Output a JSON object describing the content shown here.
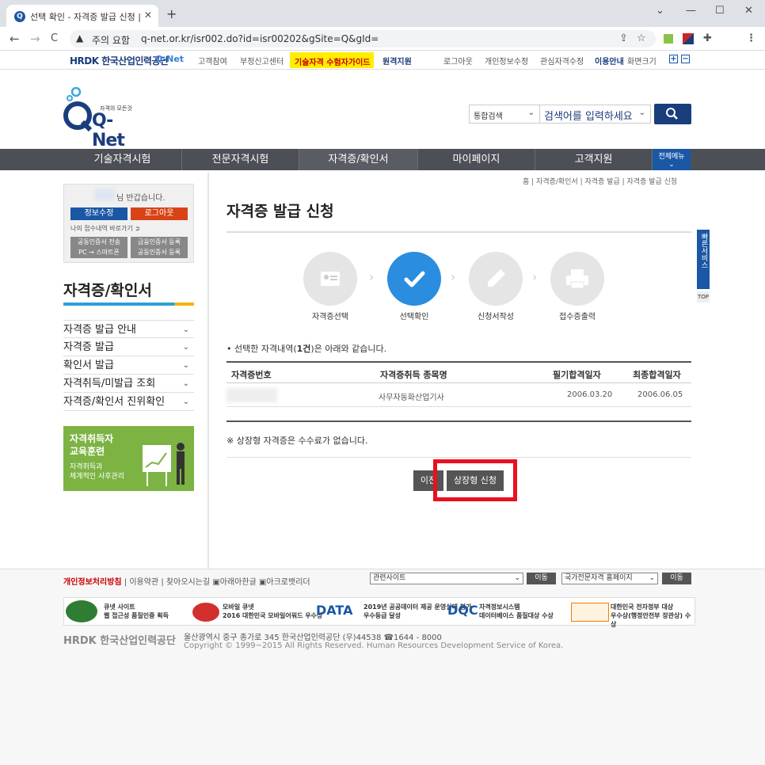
{
  "browser": {
    "tab_title": "선택 확인 - 자격증 발급 신청 | Q-",
    "tab_favicon": "Q",
    "close": "✕",
    "new_tab": "+",
    "win": [
      "⌄",
      "—",
      "☐",
      "✕"
    ],
    "nav": [
      "←",
      "→",
      "C"
    ],
    "security_label": "주의 요함",
    "url": "q-net.or.kr/isr002.do?id=isr00202&gSite=Q&gId="
  },
  "util": {
    "hrdk": "HRDK 한국산업인력공단",
    "qnet": "Q-Net",
    "links": [
      "고객참여",
      "부정신고센터"
    ],
    "guide": "기술자격 수험자가이드",
    "remote": "원격지원",
    "right_links": [
      "로그아웃",
      "개인정보수정",
      "관심자격수정",
      "이용안내",
      "화면크기"
    ],
    "plus": "+",
    "minus": "−"
  },
  "header": {
    "logo_sub": "자격의 모든것",
    "logo_main": "Q-Net",
    "search_type": "통합검색",
    "search_placeholder": "검색어를 입력하세요"
  },
  "gnb": {
    "items": [
      "기술자격시험",
      "전문자격시험",
      "자격증/확인서",
      "마이페이지",
      "고객지원"
    ],
    "all_menu": "전체메뉴"
  },
  "login": {
    "welcome": "님 반갑습니다.",
    "edit": "정보수정",
    "logout": "로그아웃",
    "history": "나의 접수내역 바로가기",
    "cert_transfer": "공동인증서 전송",
    "pc_smart": "PC → 스마트폰",
    "fin_cert": "금융인증서 등록",
    "joint_cert": "공동인증서 등록"
  },
  "sidebar": {
    "title": "자격증/확인서",
    "items": [
      "자격증 발급 안내",
      "자격증 발급",
      "확인서 발급",
      "자격취득/미발급 조회",
      "자격증/확인서 진위확인"
    ],
    "banner_title": "자격취득자\n교육훈련",
    "banner_sub": "자격취득과\n체계적인 사후관리"
  },
  "main": {
    "breadcrumb": "홈 | 자격증/확인서 | 자격증 발급 | 자격증 발급 신청",
    "title": "자격증 발급 신청",
    "steps": [
      "자격증선택",
      "선택확인",
      "신청서작성",
      "접수증출력"
    ],
    "notice_prefix": "• 선택한 자격내역(",
    "notice_count": "1건",
    "notice_suffix": ")은 아래와 같습니다.",
    "columns": [
      "자격증번호",
      "자격증취득 종목명",
      "필기합격일자",
      "최종합격일자"
    ],
    "row": {
      "name": "사무자동화산업기사",
      "written": "2006.03.20",
      "final": "2006.06.05"
    },
    "fee_notice": "※ 상장형 자격증은 수수료가 없습니다.",
    "prev_btn": "이전",
    "apply_btn": "상장형 신청",
    "quick": "빠른서비스",
    "top": "TOP"
  },
  "footer": {
    "privacy": "개인정보처리방침",
    "links": [
      "이용약관",
      "찾아오시는길",
      "아래아한글",
      "아크로뱃리더"
    ],
    "related": "관련사이트",
    "national": "국가전문자격 홈페이지",
    "go": "이동",
    "awards": [
      "큐넷 사이트\n웹 접근성 품질인증 획득",
      "모바일 큐넷\n2016 대한민국 모바일어워드 우수상",
      "2019년 공공데이터 제공 운영실태 평가\n우수등급 달성",
      "자격정보시스템\n데이터베이스 품질대상 수상",
      "대한민국 전자정부 대상\n우수상(행정안전부 장관상) 수상"
    ],
    "hrdk": "HRDK 한국산업인력공단",
    "address": "울산광역시 중구 종가로 345 한국산업인력공단 (우)44538 ☎1644 - 8000",
    "copyright": "Copyright © 1999~2015 All Rights Reserved. Human Resources Development Service of Korea."
  }
}
